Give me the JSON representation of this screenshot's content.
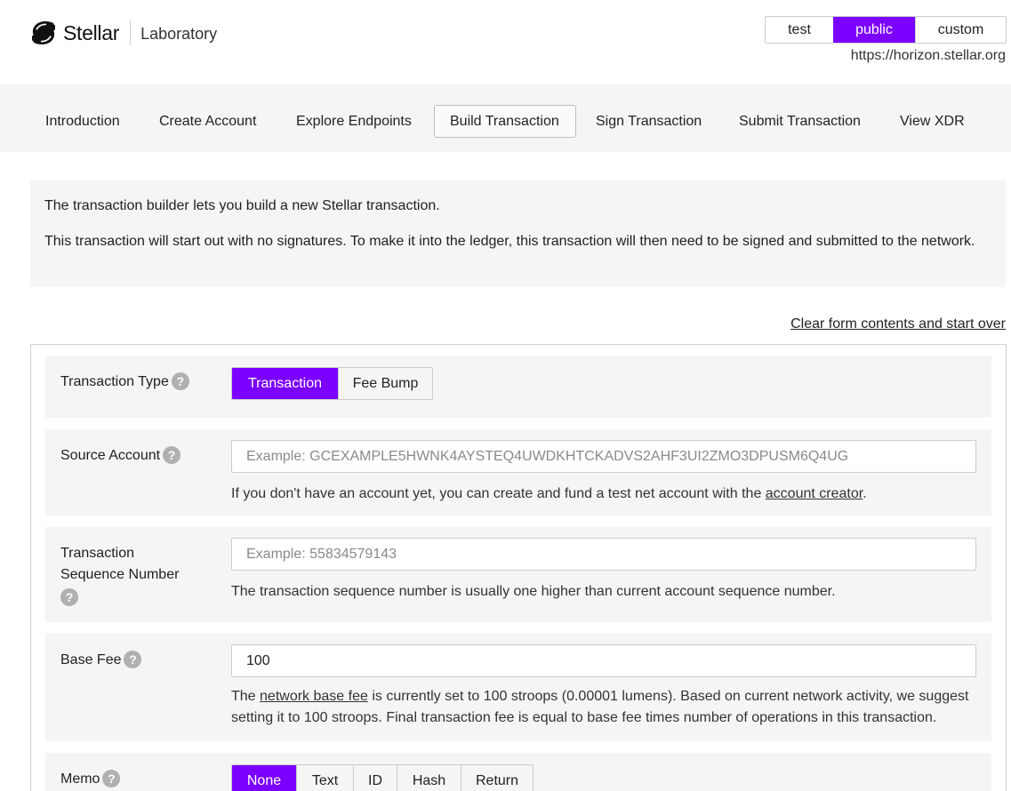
{
  "header": {
    "brand": "Stellar",
    "subtitle": "Laboratory",
    "networks": [
      "test",
      "public",
      "custom"
    ],
    "active_network": "public",
    "horizon_url": "https://horizon.stellar.org"
  },
  "nav": {
    "items": [
      "Introduction",
      "Create Account",
      "Explore Endpoints",
      "Build Transaction",
      "Sign Transaction",
      "Submit Transaction",
      "View XDR"
    ],
    "active": "Build Transaction"
  },
  "intro": {
    "line1": "The transaction builder lets you build a new Stellar transaction.",
    "line2": "This transaction will start out with no signatures. To make it into the ledger, this transaction will then need to be signed and submitted to the network."
  },
  "clear_link": "Clear form contents and start over",
  "form": {
    "tx_type": {
      "label": "Transaction Type",
      "options": [
        "Transaction",
        "Fee Bump"
      ],
      "selected": "Transaction"
    },
    "source": {
      "label": "Source Account",
      "placeholder": "Example: GCEXAMPLE5HWNK4AYSTEQ4UWDKHTCKADVS2AHF3UI2ZMO3DPUSM6Q4UG",
      "note_prefix": "If you don't have an account yet, you can create and fund a test net account with the ",
      "note_link": "account creator",
      "note_suffix": "."
    },
    "sequence": {
      "label_line1": "Transaction",
      "label_line2": "Sequence Number",
      "placeholder": "Example: 55834579143",
      "note": "The transaction sequence number is usually one higher than current account sequence number."
    },
    "base_fee": {
      "label": "Base Fee",
      "value": "100",
      "note_prefix": "The ",
      "note_link": "network base fee",
      "note_suffix": " is currently set to 100 stroops (0.00001 lumens). Based on current network activity, we suggest setting it to 100 stroops. Final transaction fee is equal to base fee times number of operations in this transaction."
    },
    "memo": {
      "label": "Memo",
      "options": [
        "None",
        "Text",
        "ID",
        "Hash",
        "Return"
      ],
      "selected": "None"
    }
  },
  "help_glyph": "?",
  "colors": {
    "accent": "#7b00ff",
    "panel": "#f5f5f5",
    "help": "#b0b0b0"
  }
}
